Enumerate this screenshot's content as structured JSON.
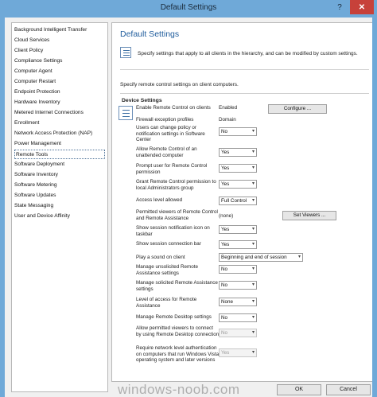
{
  "window": {
    "title": "Default Settings",
    "help": "?",
    "close": "✕"
  },
  "sidebar": {
    "items": [
      "Background Intelligent Transfer",
      "Cloud Services",
      "Client Policy",
      "Compliance Settings",
      "Computer Agent",
      "Computer Restart",
      "Endpoint Protection",
      "Hardware Inventory",
      "Metered Internet Connections",
      "Enrollment",
      "Network Access Protection (NAP)",
      "Power Management",
      "Remote Tools",
      "Software Deployment",
      "Software Inventory",
      "Software Metering",
      "Software Updates",
      "State Messaging",
      "User and Device Affinity"
    ],
    "selected": "Remote Tools"
  },
  "main": {
    "title": "Default Settings",
    "description": "Specify settings that apply to all clients in the hierarchy, and can be modified by custom settings.",
    "intro": "Specify remote control settings on client computers.",
    "group_title": "Device Settings",
    "rows": [
      {
        "label": "Enable Remote Control on clients",
        "value": "Enabled",
        "button": "Configure ..."
      },
      {
        "label": "Firewall exception profiles",
        "value": "Domain"
      },
      {
        "label": "Users can change policy or notification settings in Software Center",
        "select": "No"
      },
      {
        "label": "Allow Remote Control of an unattended computer",
        "select": "Yes"
      },
      {
        "label": "Prompt user for Remote Control permission",
        "select": "Yes"
      },
      {
        "label": "Grant Remote Control permission to local Administrators group",
        "select": "Yes"
      },
      {
        "label": "Access level allowed",
        "select": "Full Control"
      },
      {
        "label": "Permitted viewers of Remote Control and Remote Assistance",
        "value": "(none)",
        "button": "Set Viewers ..."
      },
      {
        "label": "Show session notification icon on taskbar",
        "select": "Yes"
      },
      {
        "label": "Show session connection bar",
        "select": "Yes"
      },
      {
        "label": "Play a sound on client",
        "select": "Beginning and end of session"
      },
      {
        "label": "Manage unsolicited Remote Assistance settings",
        "select": "No"
      },
      {
        "label": "Manage solicited Remote Assistance settings",
        "select": "No"
      },
      {
        "label": "Level of access for Remote Assistance",
        "select": "None"
      },
      {
        "label": "Manage Remote Desktop settings",
        "select": "No"
      },
      {
        "label": "Allow permitted viewers to connect by using Remote Desktop connection",
        "select": "No"
      },
      {
        "label": "Require network level authentication on computers that run Windows Vista operating system and later versions",
        "select": "Yes"
      }
    ]
  },
  "footer": {
    "ok": "OK",
    "cancel": "Cancel"
  },
  "watermark": "windows-noob.com"
}
